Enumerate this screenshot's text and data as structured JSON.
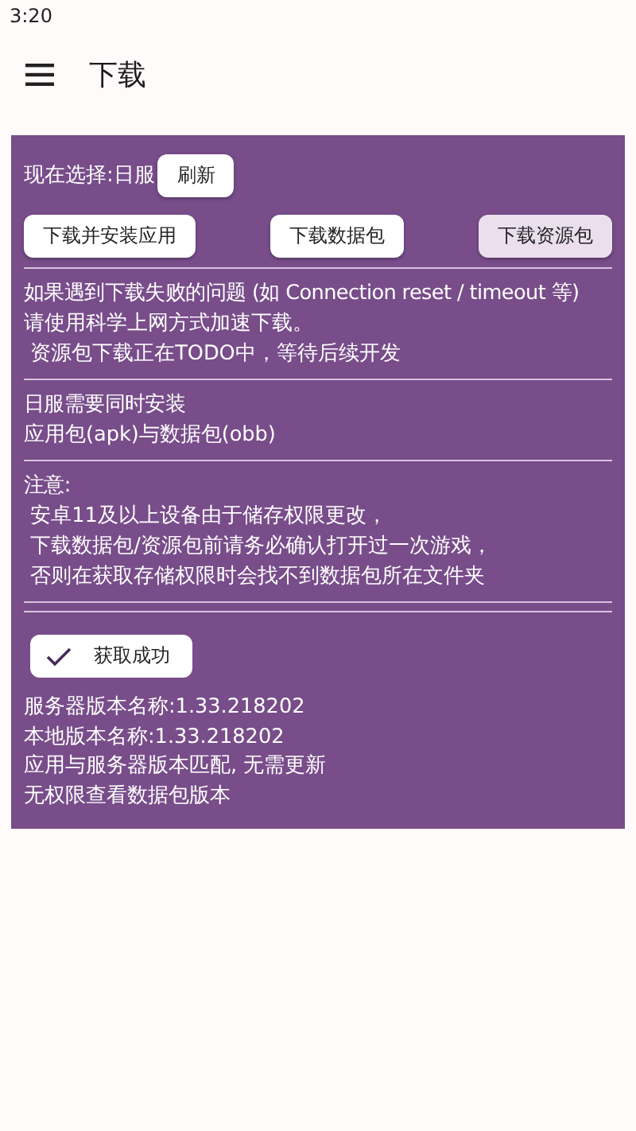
{
  "status_bar": {
    "time": "3:20"
  },
  "app_bar": {
    "title": "下载"
  },
  "panel": {
    "selection_label": "现在选择:日服",
    "refresh_button": "刷新",
    "download_buttons": [
      {
        "label": "下载并安装应用",
        "selected": false
      },
      {
        "label": "下载数据包",
        "selected": false
      },
      {
        "label": "下载资源包",
        "selected": true
      }
    ],
    "sections": [
      {
        "lines": [
          "如果遇到下载失败的问题 (如 Connection reset / timeout 等)",
          "请使用科学上网方式加速下载。",
          " 资源包下载正在TODO中，等待后续开发"
        ]
      },
      {
        "lines": [
          "日服需要同时安装",
          "应用包(apk)与数据包(obb)"
        ]
      },
      {
        "lines": [
          "注意:",
          " 安卓11及以上设备由于储存权限更改，",
          " 下载数据包/资源包前请务必确认打开过一次游戏，",
          " 否则在获取存储权限时会找不到数据包所在文件夹"
        ]
      }
    ],
    "permission_chip": {
      "label": "获取成功",
      "checked": true
    },
    "info_lines": [
      "服务器版本名称:1.33.218202",
      "本地版本名称:1.33.218202",
      "应用与服务器版本匹配, 无需更新",
      "无权限查看数据包版本"
    ]
  }
}
